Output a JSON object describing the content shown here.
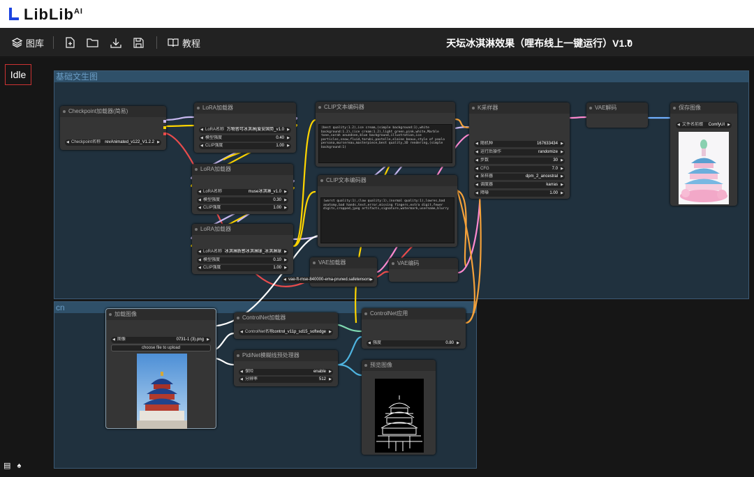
{
  "brand": {
    "name": "LibLib",
    "mark": "AI"
  },
  "toolbar": {
    "gallery": "图库",
    "tutorial": "教程",
    "workflow_title": "天坛冰淇淋效果（哩布线上一键运行）V1.0"
  },
  "status": {
    "idle": "Idle"
  },
  "groups": {
    "basic": "基础文生图",
    "cn": "cn"
  },
  "nodes": {
    "checkpoint": {
      "title": "Checkpoint加载器(简易)",
      "label": "Checkpoint名称",
      "value": "revAnimated_v122_V1.2.2"
    },
    "lora1": {
      "title": "LoRA加载器",
      "name_label": "LoRA名称",
      "name": "万物皆可冰淇淋|爱安固势_v1.0",
      "model_label": "模型强度",
      "model": "0.40",
      "clip_label": "CLIP强度",
      "clip": "1.00"
    },
    "lora2": {
      "title": "LoRA加载器",
      "name_label": "LoRA名称",
      "name": "muse冰淇淋_v1.0",
      "model_label": "模型强度",
      "model": "0.30",
      "clip_label": "CLIP强度",
      "clip": "1.00"
    },
    "lora3": {
      "title": "LoRA加载器",
      "name_label": "LoRA名称",
      "name": "冰淇淋质感冰淇淋球_冰淇淋球",
      "model_label": "模型强度",
      "model": "0.10",
      "clip_label": "CLIP强度",
      "clip": "1.00"
    },
    "clip_pos": {
      "title": "CLIP文本编码器",
      "text": "(best quality:1.2),ice cream,(simple background:1),white background:1.2),(ice cream:1.2),light green,pink,white,Marble tone,sarah anundsen,blue background,illustration,ice particles,snow,fluid,torubi,pastelle,elaine beaux,style of paolo persona,mursereau,masterpiece,best quality,3D rendering,(simple background:1)"
    },
    "clip_neg": {
      "title": "CLIP文本编码器",
      "text": "(worst quality:1),(low quality:1),(normal quality:1),lowres,bad anatomy,bad hands,text,error,missing fingers,extra digit,fewer digits,cropped,jpeg artifacts,signature,watermark,username,blurry"
    },
    "ksampler": {
      "title": "K采样器",
      "seed_label": "随机种",
      "seed": "167633434",
      "ctrl_label": "运行后操作",
      "ctrl": "randomize",
      "steps_label": "步数",
      "steps": "30",
      "cfg_label": "CFG",
      "cfg": "7.0",
      "sampler_label": "采样器",
      "sampler": "dpm_2_ancestral",
      "sched_label": "调度器",
      "sched": "karras",
      "denoise_label": "降噪",
      "denoise": "1.00"
    },
    "vae_decode": {
      "title": "VAE解码"
    },
    "save": {
      "title": "保存图像",
      "prefix_label": "文件名前缀",
      "prefix": "ComfyUI"
    },
    "vae_loader": {
      "title": "VAE加载器",
      "value": "vae-ft-mse-840000-ema-pruned.safetensors"
    },
    "vae_encode": {
      "title": "VAE编码"
    },
    "load_image": {
      "title": "加载图像",
      "image_label": "图像",
      "image": "0731-1 (3).png",
      "upload": "choose file to upload"
    },
    "cn_loader": {
      "title": "ControlNet加载器",
      "label": "ControlNet名称",
      "value": "control_v11p_sd15_softedge"
    },
    "pidinet": {
      "title": "PidiNet模糊线预处理器",
      "safe_label": "保险",
      "safe": "enable",
      "res_label": "分辨率",
      "res": "512"
    },
    "cn_apply": {
      "title": "ControlNet应用",
      "strength_label": "强度",
      "strength": "0.80"
    },
    "preview": {
      "title": "预览图像"
    }
  }
}
